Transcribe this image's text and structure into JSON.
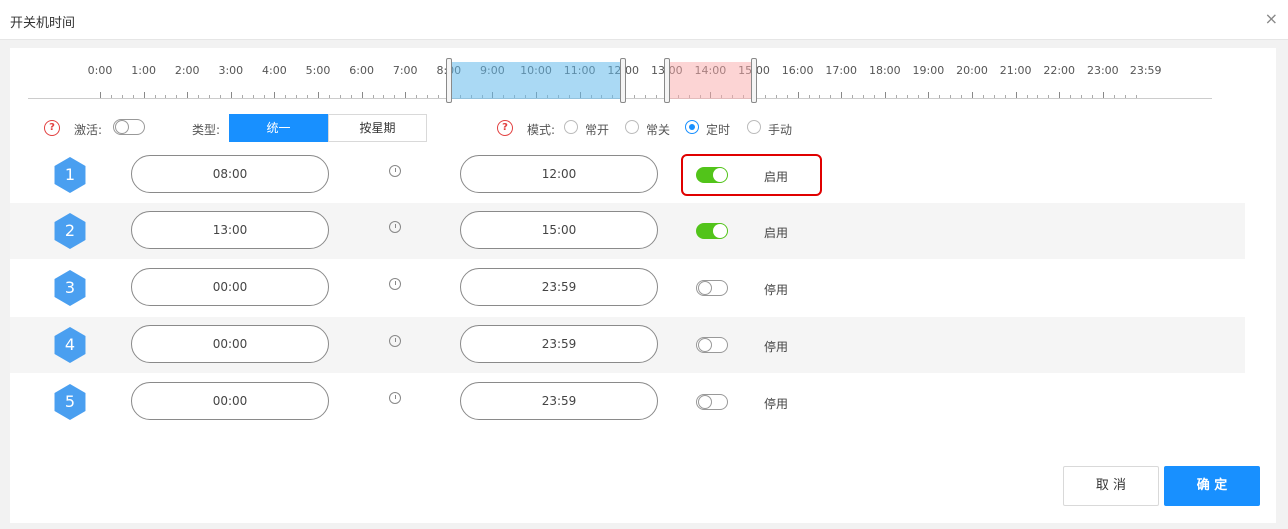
{
  "dialog": {
    "title": "开关机时间",
    "close_glyph": "×"
  },
  "timeline": {
    "hour_labels": [
      "0:00",
      "1:00",
      "2:00",
      "3:00",
      "4:00",
      "5:00",
      "6:00",
      "7:00",
      "8:00",
      "9:00",
      "10:00",
      "11:00",
      "12:00",
      "13:00",
      "14:00",
      "15:00",
      "16:00",
      "17:00",
      "18:00",
      "19:00",
      "20:00",
      "21:00",
      "22:00",
      "23:00",
      "23:59"
    ],
    "ranges": [
      {
        "start": "08:00",
        "end": "12:00",
        "color": "#64b9eb"
      },
      {
        "start": "13:00",
        "end": "15:00",
        "color": "#faaaaa"
      }
    ]
  },
  "controls": {
    "help_glyph": "?",
    "activate_label": "激活:",
    "activate_on": false,
    "type_label": "类型:",
    "type_options": [
      "统一",
      "按星期"
    ],
    "type_selected": "统一",
    "mode_label": "模式:",
    "mode_options": [
      "常开",
      "常关",
      "定时",
      "手动"
    ],
    "mode_selected": "定时"
  },
  "schedules": [
    {
      "index": "1",
      "start": "08:00",
      "end": "12:00",
      "enabled": true,
      "status": "启用"
    },
    {
      "index": "2",
      "start": "13:00",
      "end": "15:00",
      "enabled": true,
      "status": "启用"
    },
    {
      "index": "3",
      "start": "00:00",
      "end": "23:59",
      "enabled": false,
      "status": "停用"
    },
    {
      "index": "4",
      "start": "00:00",
      "end": "23:59",
      "enabled": false,
      "status": "停用"
    },
    {
      "index": "5",
      "start": "00:00",
      "end": "23:59",
      "enabled": false,
      "status": "停用"
    }
  ],
  "buttons": {
    "cancel": "取 消",
    "ok": "确 定"
  },
  "colors": {
    "primary": "#1890ff",
    "toggle_on": "#52c41a",
    "highlight": "#e00000",
    "help": "#e24040"
  }
}
